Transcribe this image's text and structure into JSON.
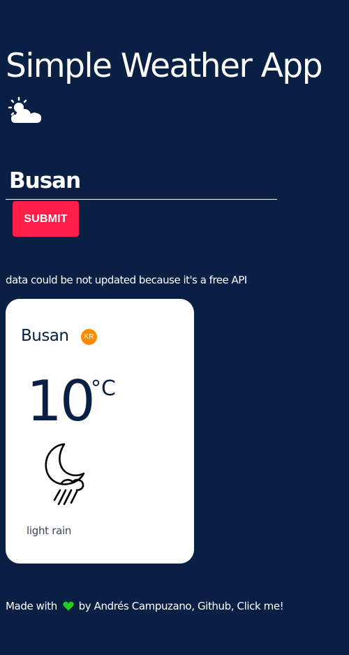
{
  "app": {
    "title": "Simple Weather App",
    "title_icon": "sun-behind-cloud-icon"
  },
  "search": {
    "value": "Busan",
    "placeholder": "",
    "submit_label": "SUBMIT"
  },
  "disclaimer": "data could be not updated because it's a free API",
  "weather_card": {
    "city": "Busan",
    "country_code": "KR",
    "temperature": "10",
    "unit": "°C",
    "icon": "night-rain-icon",
    "description": "light rain"
  },
  "footer": {
    "prefix": "Made with",
    "heart_icon": "heart-icon",
    "by_text": "by Andrés Campuzano,",
    "github_label": "Github,",
    "click_label": "Click me!"
  },
  "colors": {
    "background": "#0a1f44",
    "submit_button": "#ff1f48",
    "country_badge": "#ff8c00",
    "card": "#ffffff",
    "heart": "#22cc22"
  }
}
